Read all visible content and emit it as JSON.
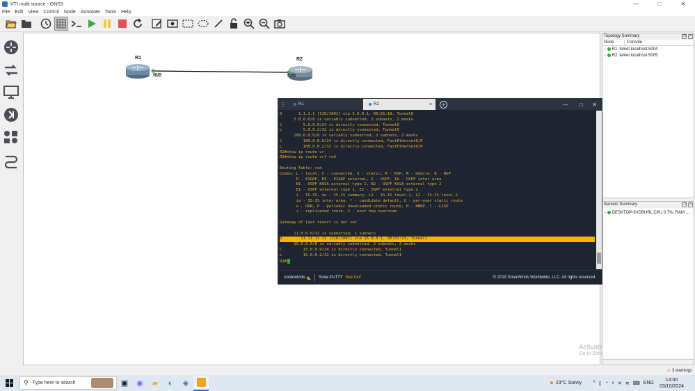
{
  "window": {
    "title": "VTI multi source - GNS3",
    "minimize": "—",
    "maximize": "□",
    "close": "✕"
  },
  "menu": [
    "File",
    "Edit",
    "View",
    "Control",
    "Node",
    "Annotate",
    "Tools",
    "Help"
  ],
  "toolbar_icons": [
    "open-folder-icon",
    "folder-icon",
    "clock-icon",
    "snapshot-grid-icon",
    "console-icon",
    "play-icon",
    "pause-icon",
    "stop-icon",
    "reload-icon",
    "edit-note-icon",
    "image-icon",
    "rectangle-icon",
    "ellipse-icon",
    "line-icon",
    "lock-icon",
    "zoom-in-icon",
    "zoom-out-icon",
    "camera-icon"
  ],
  "topology": {
    "nodes": [
      {
        "name": "R1",
        "port": "f0/0"
      },
      {
        "name": "R2",
        "port": "f0/0"
      }
    ]
  },
  "topology_summary": {
    "title": "Topology Summary",
    "columns": [
      "Node",
      "Console"
    ],
    "rows": [
      {
        "node": "R1",
        "console": "telnet localhost:5004"
      },
      {
        "node": "R2",
        "console": "telnet localhost:5005"
      }
    ]
  },
  "servers_summary": {
    "title": "Servers Summary",
    "rows": [
      {
        "label": "DESKTOP-9VDBHRL CPU 0.7%, RAM ..."
      }
    ]
  },
  "terminal": {
    "tabs": [
      {
        "label": "R1"
      },
      {
        "label": "R2",
        "close": "×"
      }
    ],
    "add_tab": "+",
    "lines": [
      "O       1.1.1.1 [110/1001] via 5.0.0.1, 00:01:18, Tunnel0",
      "      5.0.0.0/8 is variably subnetted, 2 subnets, 2 masks",
      "C         5.0.0.0/24 is directly connected, Tunnel0",
      "L         5.0.0.2/32 is directly connected, Tunnel0",
      "      100.0.0.0/8 is variably subnetted, 2 subnets, 2 masks",
      "C         100.0.0.0/24 is directly connected, FastEthernet0/0",
      "L         100.0.0.2/32 is directly connected, FastEthernet0/0",
      "R2#show ip route vr",
      "R2#show ip route vrf red",
      "",
      "Routing Table: red",
      "Codes: L - local, C - connected, S - static, R - RIP, M - mobile, B - BGP",
      "       D - EIGRP, EX - EIGRP external, O - OSPF, IA - OSPF inter area",
      "       N1 - OSPF NSSA external type 1, N2 - OSPF NSSA external type 2",
      "       E1 - OSPF external type 1, E2 - OSPF external type 2",
      "       i - IS-IS, su - IS-IS summary, L1 - IS-IS level-1, L2 - IS-IS level-2",
      "       ia - IS-IS inter area, * - candidate default, U - per-user static route",
      "       o - ODR, P - periodic downloaded static route, H - NHRP, l - LISP",
      "       + - replicated route, % - next hop override",
      "",
      "Gateway of last resort is not set",
      "",
      "      11.0.0.0/32 is subnetted, 1 subnets",
      "O        11.11.11.11 [110/1001] via 15.0.0.1, 00:01:13, Tunnel1",
      "      15.0.0.0/8 is variably subnetted, 2 subnets, 2 masks",
      "C         15.0.0.0/24 is directly connected, Tunnel1",
      "L         15.0.0.2/32 is directly connected, Tunnel1",
      "R2#"
    ],
    "highlight_line": 23,
    "brand": "solarwinds",
    "product": "Solar-PuTTY",
    "product_tag": "free tool",
    "copyright": "© 2019 SolarWinds Worldwide, LLC. All rights reserved."
  },
  "watermark": {
    "line1": "Activate Windows",
    "line2": "Go to Settings to activate Windows."
  },
  "status": {
    "warnings": "3 warnings"
  },
  "taskbar": {
    "search_placeholder": "Type here to search",
    "weather": "23°C  Sunny",
    "lang": "ENG",
    "time": "14:00",
    "date": "03/10/2024"
  },
  "colors": {
    "terminal_text": "#e8b23c",
    "highlight": "#f4b400",
    "link": "#000000",
    "status_green": "#2eaa3f"
  }
}
